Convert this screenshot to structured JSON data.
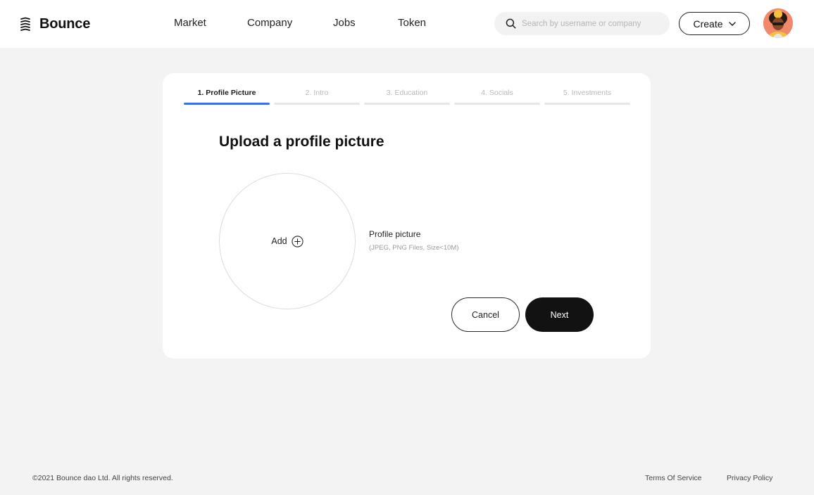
{
  "header": {
    "brand": "Bounce",
    "nav": [
      {
        "label": "Market"
      },
      {
        "label": "Company"
      },
      {
        "label": "Jobs"
      },
      {
        "label": "Token"
      }
    ],
    "search": {
      "placeholder": "Search by username or company",
      "value": ""
    },
    "create_label": "Create",
    "avatar_icon": "user-avatar"
  },
  "steps": [
    {
      "label": "1. Profile Picture",
      "active": true
    },
    {
      "label": "2. Intro",
      "active": false
    },
    {
      "label": "3. Education",
      "active": false
    },
    {
      "label": "4. Socials",
      "active": false
    },
    {
      "label": "5. Investments",
      "active": false
    }
  ],
  "content": {
    "title": "Upload a profile picture",
    "add_label": "Add",
    "picture_label": "Profile picture",
    "picture_hint": "(JPEG, PNG Files, Size<10M)"
  },
  "actions": {
    "cancel": "Cancel",
    "next": "Next"
  },
  "footer": {
    "copyright": "©2021 Bounce dao Ltd. All rights reserved.",
    "terms": "Terms Of Service",
    "privacy": "Privacy Policy"
  },
  "colors": {
    "accent": "#3a6cf0",
    "primary_button": "#121212",
    "page_background": "#f3f3f3"
  }
}
